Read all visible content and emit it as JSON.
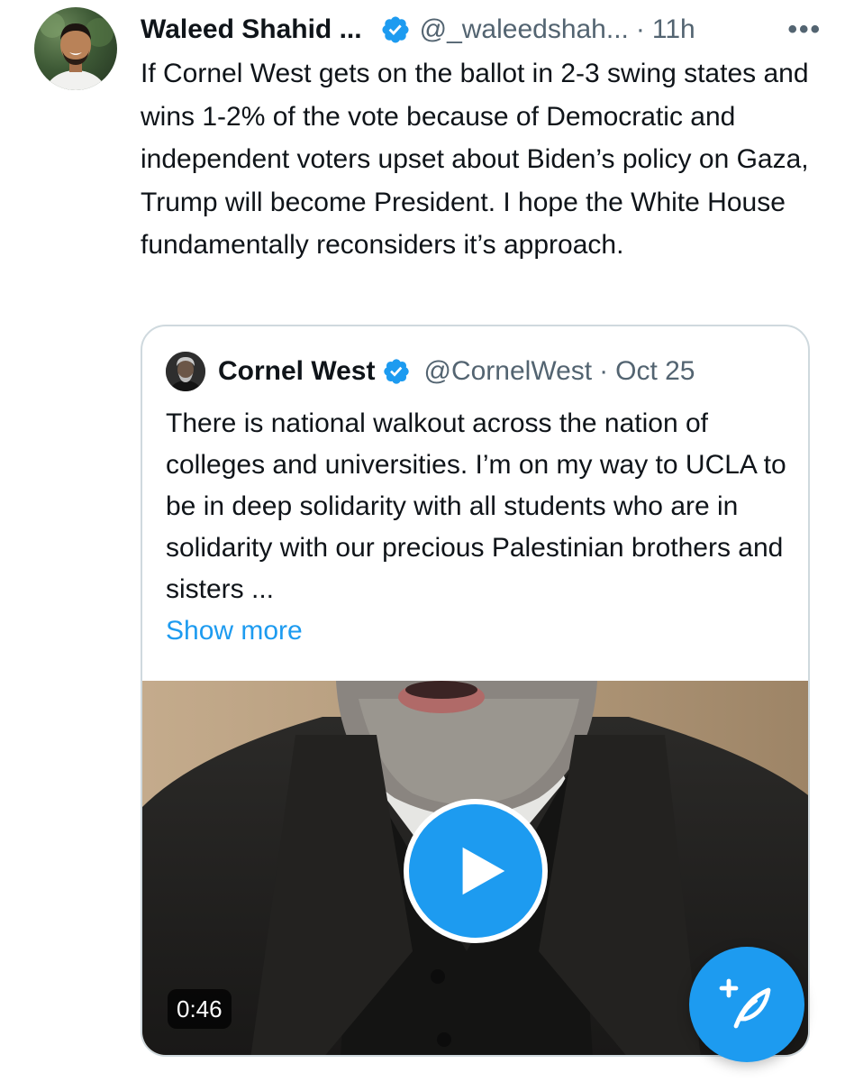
{
  "tweet": {
    "author_name": "Waleed Shahid ...",
    "handle": "@_waleedshah...",
    "separator": "·",
    "time": "11h",
    "more_label": "•••",
    "body": "If Cornel West gets on the ballot in 2-3 swing states and wins 1-2% of the vote because of Democratic and independent voters upset about Biden’s policy on Gaza, Trump will become President. I hope the White House fundamentally reconsiders it’s approach."
  },
  "quote": {
    "author_name": "Cornel West",
    "handle": "@CornelWest",
    "separator": "·",
    "time": "Oct 25",
    "body": "There is national walkout across the nation of colleges and universities. I’m on my way to UCLA to be in deep solidarity with all students who are in solidarity with our precious Palestinian brothers and sisters ...",
    "show_more": "Show more",
    "video": {
      "duration": "0:46"
    }
  },
  "colors": {
    "accent": "#1d9bf0",
    "text_primary": "#0f1419",
    "text_secondary": "#536471",
    "border": "#cfd9de"
  },
  "icons": {
    "verified": "verified-badge-icon",
    "more": "more-dots-icon",
    "play": "play-icon",
    "compose": "compose-feather-plus-icon"
  }
}
